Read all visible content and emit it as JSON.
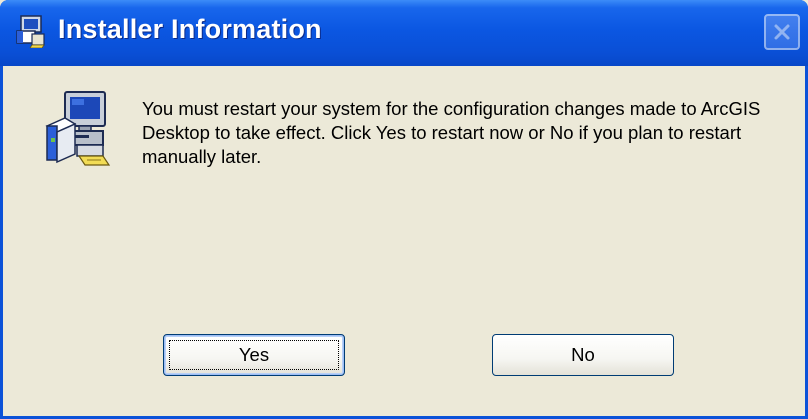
{
  "window": {
    "title": "Installer Information",
    "title_icon": "installer-icon",
    "close_icon": "close-icon"
  },
  "dialog": {
    "icon": "computer-installer-icon",
    "message": "You must restart your system for the configuration changes made to ArcGIS Desktop to take effect. Click Yes to restart now or No if you plan to restart manually later.",
    "buttons": {
      "yes_label": "Yes",
      "no_label": "No"
    }
  },
  "colors": {
    "titlebar": "#0a4fd6",
    "client": "#ece9d8",
    "button_border": "#003c74"
  }
}
